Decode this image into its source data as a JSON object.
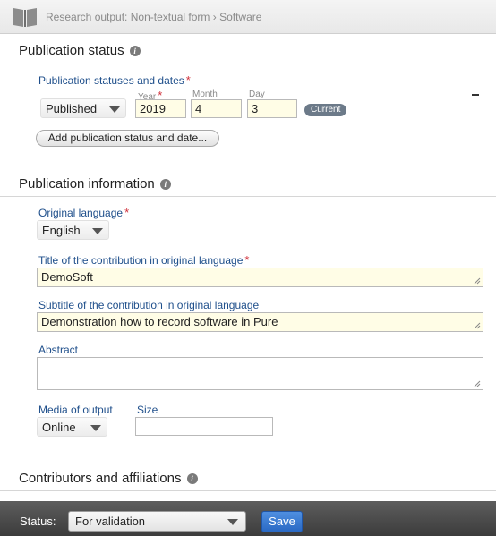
{
  "header": {
    "breadcrumb": "Research output: Non-textual form › Software",
    "icon": "book-icon"
  },
  "publication_status": {
    "title": "Publication status",
    "statuses_label": "Publication statuses and dates",
    "status_value": "Published",
    "year_label": "Year",
    "month_label": "Month",
    "day_label": "Day",
    "year_value": "2019",
    "month_value": "4",
    "day_value": "3",
    "current_badge": "Current",
    "add_button": "Add publication status and date..."
  },
  "publication_information": {
    "title": "Publication information",
    "original_language_label": "Original language",
    "original_language_value": "English",
    "title_label": "Title of the contribution in original language",
    "title_value": "DemoSoft",
    "subtitle_label": "Subtitle of the contribution in original language",
    "subtitle_value": "Demonstration how to record software in Pure",
    "abstract_label": "Abstract",
    "abstract_value": "",
    "media_label": "Media of output",
    "media_value": "Online",
    "size_label": "Size",
    "size_value": ""
  },
  "contributors": {
    "title": "Contributors and affiliations"
  },
  "footer": {
    "status_label": "Status:",
    "status_value": "For validation",
    "save_label": "Save"
  },
  "colors": {
    "accent_label": "#1f4f8b",
    "required": "#d0303a",
    "input_bg": "#fffde6",
    "save_button": "#2a69c4"
  }
}
